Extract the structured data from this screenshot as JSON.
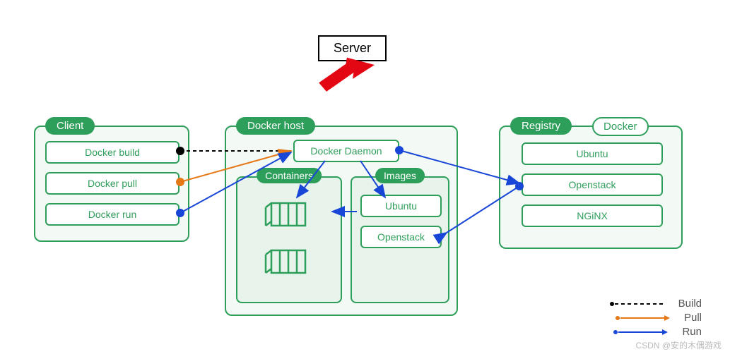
{
  "callout": {
    "label": "Server"
  },
  "client": {
    "title": "Client",
    "items": [
      "Docker build",
      "Docker pull",
      "Docker run"
    ]
  },
  "host": {
    "title": "Docker host",
    "daemon": "Docker Daemon",
    "containers": {
      "title": "Containers"
    },
    "images": {
      "title": "Images",
      "items": [
        "Ubuntu",
        "Openstack"
      ]
    }
  },
  "registry": {
    "title": "Registry",
    "tag": "Docker",
    "items": [
      "Ubuntu",
      "Openstack",
      "NGiNX"
    ]
  },
  "legend": {
    "build": "Build",
    "pull": "Pull",
    "run": "Run"
  },
  "watermark": "CSDN @安的木偶游戏"
}
